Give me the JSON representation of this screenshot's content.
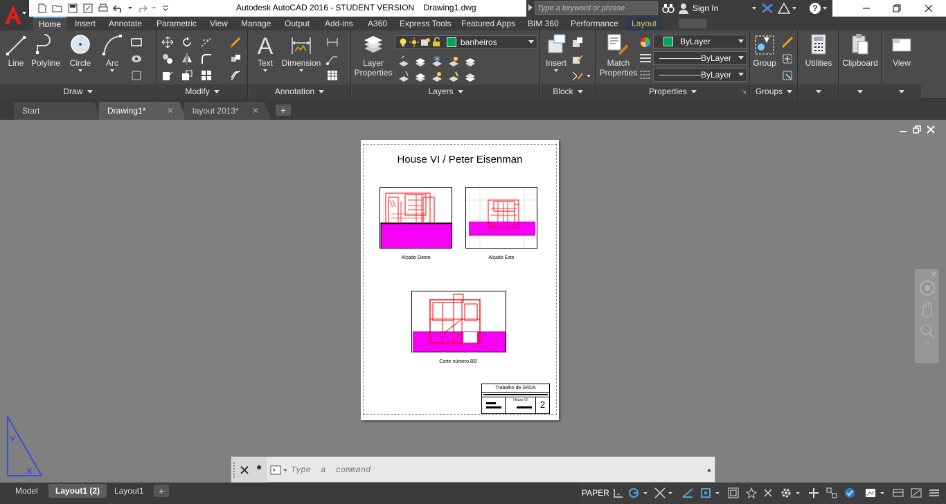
{
  "titlebar": {
    "title": "Autodesk AutoCAD 2016 - STUDENT VERSION    Drawing1.dwg",
    "search_placeholder": "Type a keyword or phrase",
    "sign_in": "Sign In"
  },
  "ribbon_tabs": [
    "Home",
    "Insert",
    "Annotate",
    "Parametric",
    "View",
    "Manage",
    "Output",
    "Add-ins",
    "A360",
    "Express Tools",
    "Featured Apps",
    "BIM 360",
    "Performance",
    "Layout"
  ],
  "ribbon": {
    "draw": {
      "title": "Draw",
      "line": "Line",
      "polyline": "Polyline",
      "circle": "Circle",
      "arc": "Arc"
    },
    "modify": {
      "title": "Modify"
    },
    "annotation": {
      "title": "Annotation",
      "text": "Text",
      "dimension": "Dimension"
    },
    "layers": {
      "title": "Layers",
      "layer_properties_1": "Layer",
      "layer_properties_2": "Properties",
      "current_layer": "banheiros"
    },
    "block": {
      "title": "Block",
      "insert": "Insert"
    },
    "properties": {
      "title": "Properties",
      "match_1": "Match",
      "match_2": "Properties",
      "color": "ByLayer",
      "linetype": "ByLayer",
      "lineweight": "ByLayer"
    },
    "groups": {
      "title": "Groups",
      "group": "Group"
    },
    "utilities": "Utilities",
    "clipboard": "Clipboard",
    "view": "View"
  },
  "doc_tabs": [
    {
      "label": "Start"
    },
    {
      "label": "Drawing1*"
    },
    {
      "label": "layout 2013*"
    }
  ],
  "sheet": {
    "title": "House VI / Peter Eisenman",
    "vp1_label": "Alçado Oeste",
    "vp2_label": "Alçado Este",
    "vp3_label": "Corte número BB´",
    "titleblock_header": "Trabalho de SRDA",
    "titleblock_name": "House VI",
    "sheet_number": "2"
  },
  "command": {
    "placeholder": "Type  a  command"
  },
  "layout_tabs": [
    "Model",
    "Layout1 (2)",
    "Layout1"
  ],
  "status": {
    "space": "PAPER"
  },
  "colors": {
    "accent": "#4fa3d9",
    "magenta": "#ff00ff",
    "red": "#ff0000",
    "layer_green": "#00a651",
    "ucs_blue": "#1e3cff"
  }
}
